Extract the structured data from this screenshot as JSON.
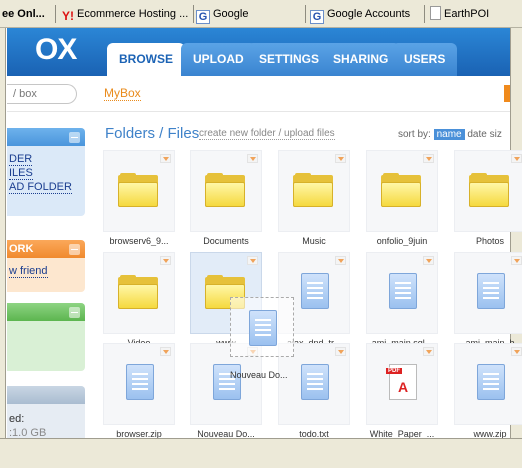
{
  "bookmarks": [
    {
      "label": "ee Onl...",
      "bold": true
    },
    {
      "label": "Ecommerce Hosting ...",
      "icon": "yahoo-icon"
    },
    {
      "label": "Google",
      "icon": "google-icon"
    },
    {
      "label": "Google Accounts",
      "icon": "google-icon"
    },
    {
      "label": "EarthPOI",
      "icon": "page-icon"
    }
  ],
  "app": {
    "logo": "OX",
    "tabs": [
      "BROWSE",
      "UPLOAD",
      "SETTINGS",
      "SHARING",
      "USERS"
    ],
    "active_tab": "BROWSE"
  },
  "subbar": {
    "search_text": "/ box",
    "breadcrumb": "MyBox"
  },
  "sidebar": {
    "panel1_links": [
      "DER",
      "ILES",
      "AD FOLDER"
    ],
    "network_title": "ORK",
    "network_link": "w friend",
    "storage_lines": [
      "ed:",
      ":1.0 GB"
    ]
  },
  "main": {
    "title": "Folders / Files",
    "actions": "create new folder / upload files",
    "sort_label": "sort by:",
    "sort_options": [
      "name",
      "date",
      "siz"
    ],
    "items": [
      {
        "label": "browserv6_9...",
        "type": "folder"
      },
      {
        "label": "Documents",
        "type": "folder"
      },
      {
        "label": "Music",
        "type": "folder"
      },
      {
        "label": "onfolio_9juin",
        "type": "folder"
      },
      {
        "label": "Photos",
        "type": "folder"
      },
      {
        "label": "Video",
        "type": "folder"
      },
      {
        "label": "www",
        "type": "folder"
      },
      {
        "label": "ajax_dnd_tr...",
        "type": "file"
      },
      {
        "label": "ami_main.sql...",
        "type": "file"
      },
      {
        "label": "ami_main_b",
        "type": "file"
      },
      {
        "label": "browser.zip",
        "type": "file"
      },
      {
        "label": "Nouveau Do...",
        "type": "file"
      },
      {
        "label": "todo.txt",
        "type": "file"
      },
      {
        "label": "White_Paper_...",
        "type": "pdf"
      },
      {
        "label": "www.zip",
        "type": "file"
      }
    ],
    "drag_label": "Nouveau Do..."
  }
}
